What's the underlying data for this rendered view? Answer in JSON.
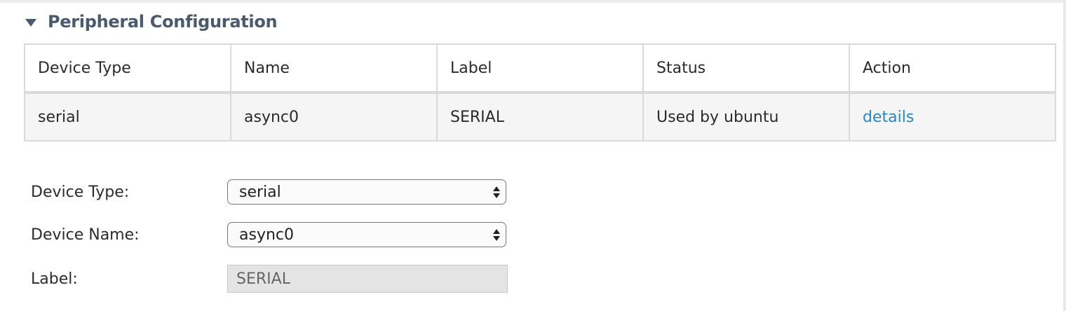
{
  "section": {
    "title": "Peripheral Configuration"
  },
  "table": {
    "headers": [
      "Device Type",
      "Name",
      "Label",
      "Status",
      "Action"
    ],
    "rows": [
      {
        "device_type": "serial",
        "name": "async0",
        "label": "SERIAL",
        "status": "Used by ubuntu",
        "action": "details"
      }
    ]
  },
  "form": {
    "device_type_label": "Device Type:",
    "device_type_value": "serial",
    "device_name_label": "Device Name:",
    "device_name_value": "async0",
    "label_label": "Label:",
    "label_value": "SERIAL"
  },
  "colors": {
    "header_text": "#4a5a6e",
    "link": "#2a86c4",
    "row_background": "#f5f5f5",
    "readonly_background": "#e4e4e4"
  },
  "icons": {
    "section_toggle": "triangle-down-icon",
    "select_arrows": "up-down-arrows-icon"
  }
}
